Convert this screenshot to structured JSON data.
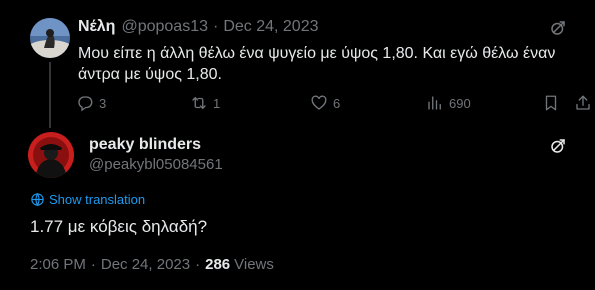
{
  "parent_tweet": {
    "display_name": "Νέλη",
    "handle": "@popoas13",
    "separator": "·",
    "date": "Dec 24, 2023",
    "text": "Μου είπε η άλλη θέλω ένα ψυγείο με ύψος 1,80. Και εγώ θέλω έναν άντρα με ύψος 1,80.",
    "replies": "3",
    "reposts": "1",
    "likes": "6",
    "views": "690",
    "icons": [
      "grok-icon",
      "reply-icon",
      "repost-icon",
      "like-icon",
      "views-icon",
      "bookmark-icon",
      "share-icon"
    ]
  },
  "main_tweet": {
    "display_name": "peaky blinders",
    "handle": "@peakybl05084561",
    "translate_label": "Show translation",
    "text": "1.77 με κόβεις δηλαδή?",
    "time": "2:06 PM",
    "separator": "·",
    "date": "Dec 24, 2023",
    "separator2": "·",
    "views_count": "286",
    "views_label": "Views"
  },
  "colors": {
    "background": "#000000",
    "text_primary": "#e7e9ea",
    "text_secondary": "#71767b",
    "link": "#1d9bf0",
    "thread_line": "#333639"
  }
}
